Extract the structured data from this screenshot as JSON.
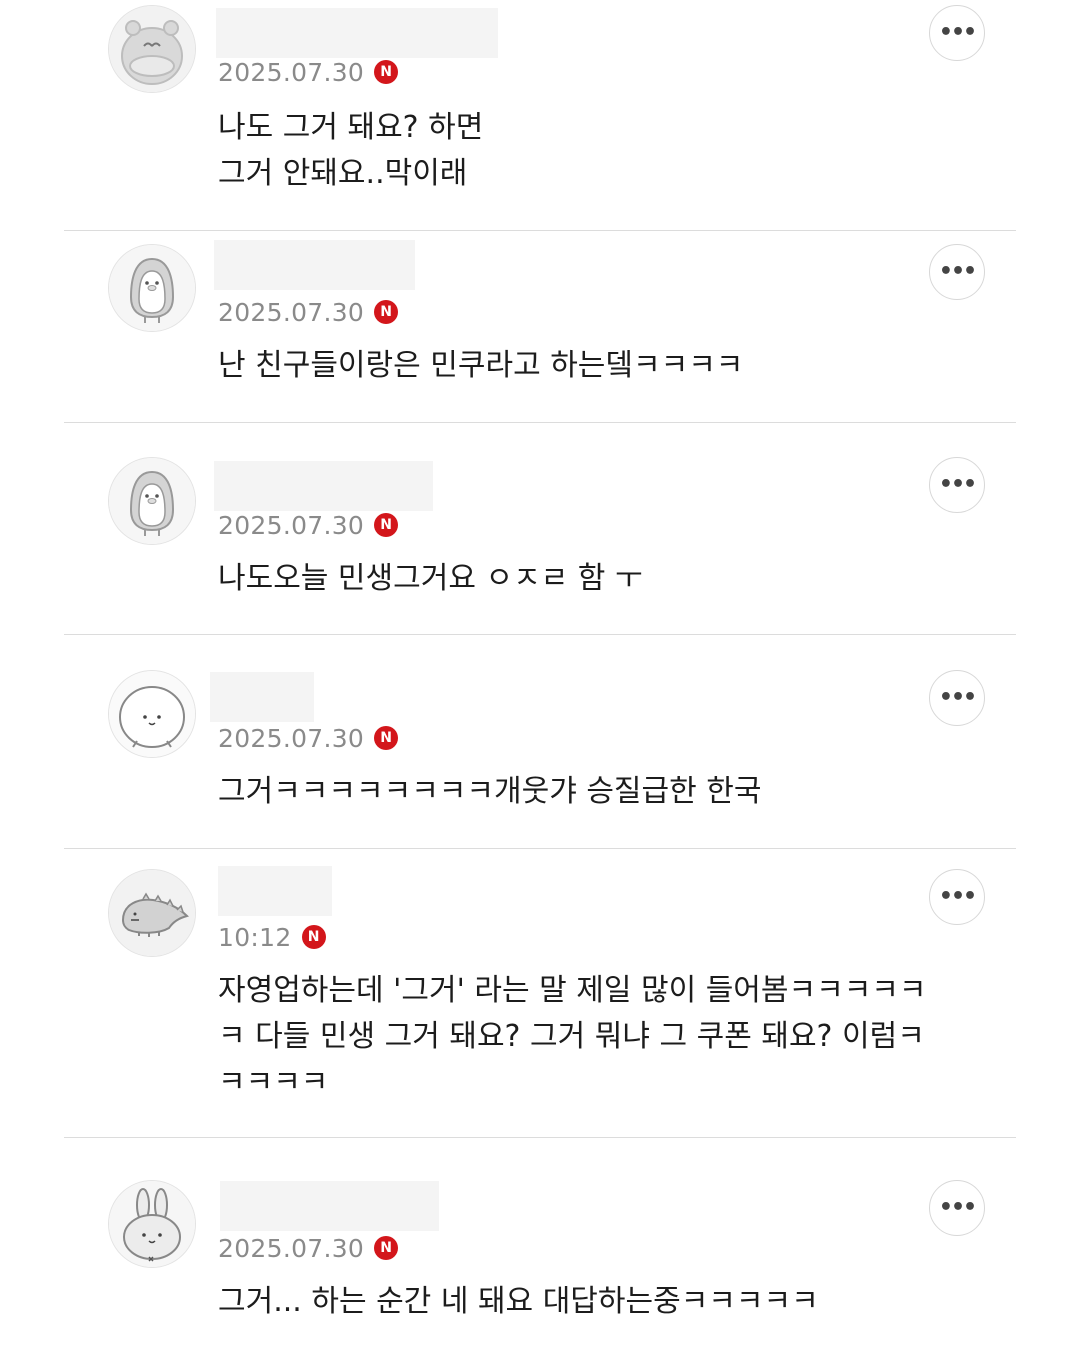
{
  "comments": [
    {
      "date": "2025.07.30",
      "badge": "N",
      "text": "나도 그거 돼요? 하면\n그거 안돼요..막이래",
      "more_icon": "more-horizontal-icon",
      "avatar": "hamster-avatar"
    },
    {
      "date": "2025.07.30",
      "badge": "N",
      "text": "난 친구들이랑은 민쿠라고 하는뎈ㅋㅋㅋㅋ",
      "more_icon": "more-horizontal-icon",
      "avatar": "penguin-avatar"
    },
    {
      "date": "2025.07.30",
      "badge": "N",
      "text": "나도오늘 민생그거요 ㅇㅈㄹ 함 ㅜ",
      "more_icon": "more-horizontal-icon",
      "avatar": "penguin-avatar"
    },
    {
      "date": "2025.07.30",
      "badge": "N",
      "text": "그거ㅋㅋㅋㅋㅋㅋㅋㅋ개웃갸 승질급한 한국",
      "more_icon": "more-horizontal-icon",
      "avatar": "round-face-avatar"
    },
    {
      "date": "10:12",
      "badge": "N",
      "text": "자영업하는데 '그거' 라는 말 제일 많이 들어봄ㅋㅋㅋㅋㅋ\nㅋ 다들 민생 그거 돼요? 그거 뭐냐 그 쿠폰 돼요? 이럼ㅋ\nㅋㅋㅋㅋ",
      "more_icon": "more-horizontal-icon",
      "avatar": "dinosaur-avatar"
    },
    {
      "date": "2025.07.30",
      "badge": "N",
      "text": "그거... 하는 순간 네 돼요 대답하는중ㅋㅋㅋㅋㅋ",
      "more_icon": "more-horizontal-icon",
      "avatar": "rabbit-avatar"
    }
  ]
}
